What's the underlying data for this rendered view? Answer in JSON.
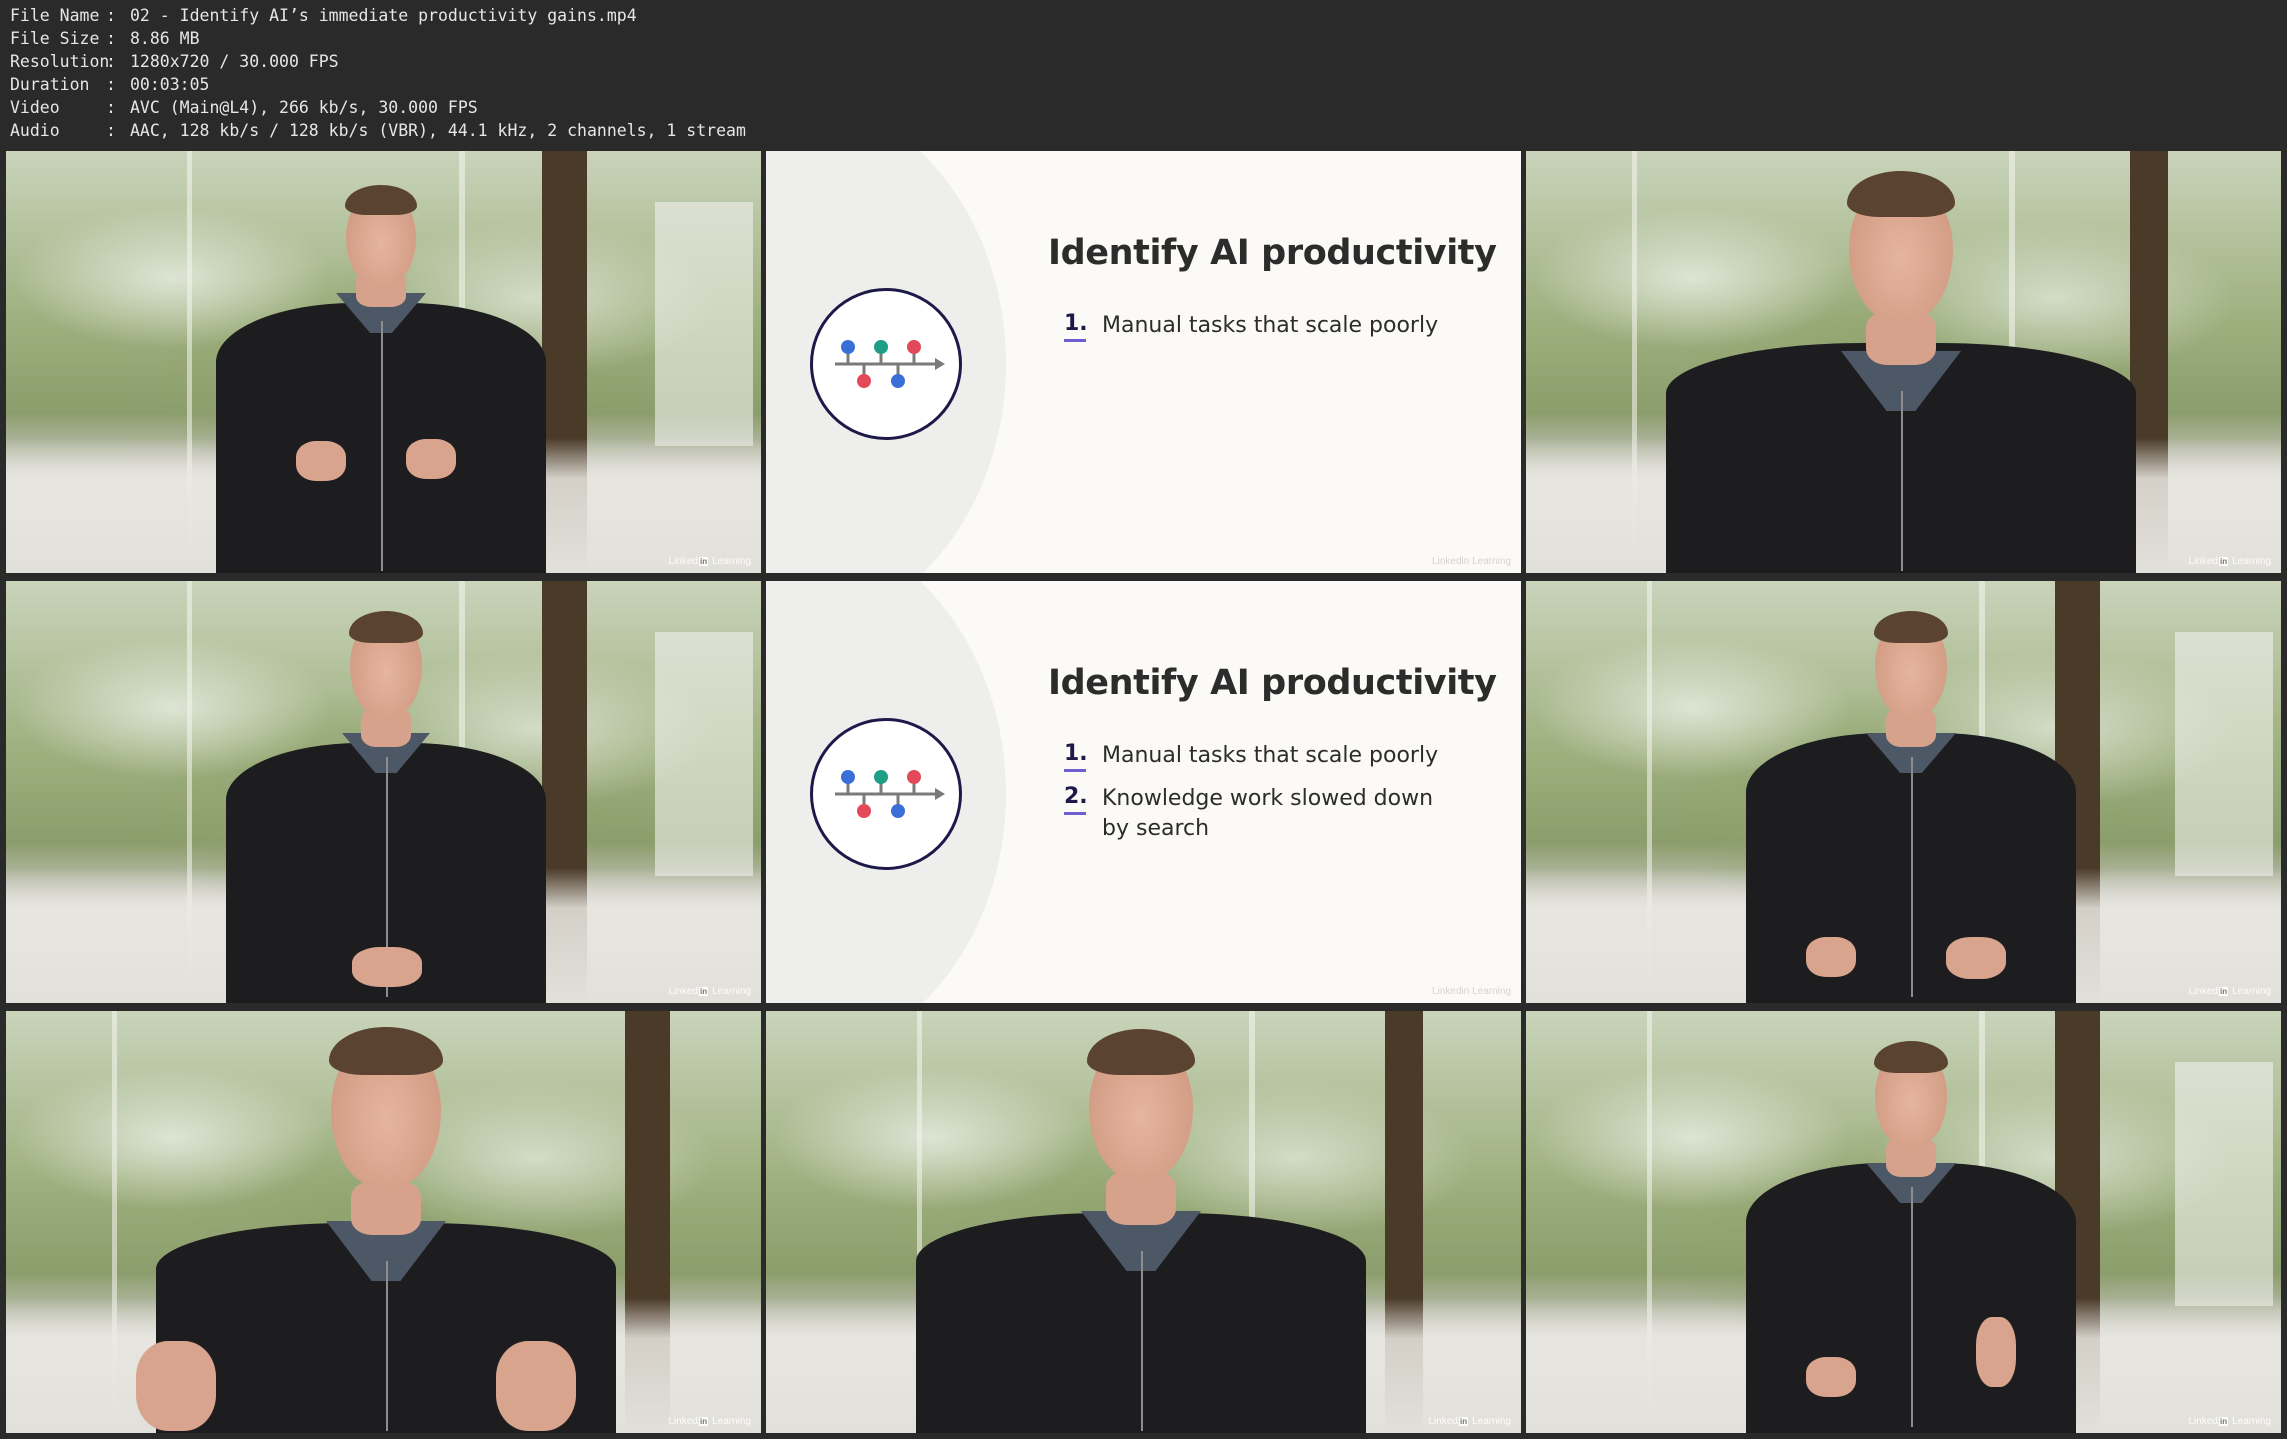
{
  "metadata": [
    {
      "key": "File Name",
      "sep": ":",
      "value": "02 - Identify AI’s immediate productivity gains.mp4"
    },
    {
      "key": "File Size",
      "sep": ":",
      "value": "8.86 MB"
    },
    {
      "key": "Resolution",
      "sep": ":",
      "value": "1280x720 / 30.000 FPS"
    },
    {
      "key": "Duration",
      "sep": ":",
      "value": "00:03:05"
    },
    {
      "key": "Video",
      "sep": ":",
      "value": "AVC (Main@L4), 266 kb/s, 30.000 FPS"
    },
    {
      "key": "Audio",
      "sep": ":",
      "value": "AAC, 128 kb/s / 128 kb/s (VBR), 44.1 kHz, 2 channels, 1 stream"
    }
  ],
  "watermark": {
    "brand_left": "Linked",
    "brand_box": "in",
    "brand_right": "Learning"
  },
  "slides": [
    {
      "title": "Identify AI productivity",
      "items": [
        {
          "num": "1.",
          "text": "Manual tasks that scale poorly"
        }
      ]
    },
    {
      "title": "Identify AI productivity",
      "items": [
        {
          "num": "1.",
          "text": "Manual tasks that scale poorly"
        },
        {
          "num": "2.",
          "text": "Knowledge work slowed down by search"
        }
      ]
    }
  ],
  "colors": {
    "background": "#2a2a2a",
    "slide_bg": "#fbfaf6",
    "accent_navy": "#1d1a4a",
    "accent_purple": "#6d5fd3",
    "dot_blue": "#3b6fd8",
    "dot_green": "#1f9e86",
    "dot_red": "#e24a5a"
  }
}
